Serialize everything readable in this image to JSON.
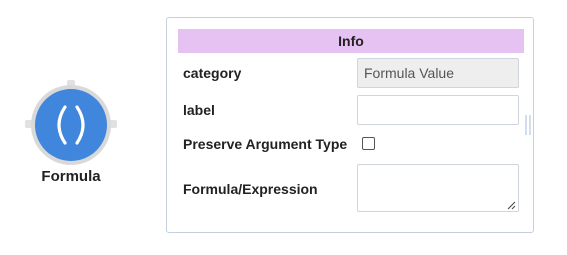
{
  "node": {
    "label": "Formula",
    "icon": "parentheses-icon",
    "color": "#3f86dc"
  },
  "info_panel": {
    "title": "Info",
    "header_color": "#e5c2f1",
    "fields": {
      "category": {
        "label": "category",
        "value": "Formula Value"
      },
      "label": {
        "label": "label",
        "value": ""
      },
      "preserve_argument_type": {
        "label": "Preserve Argument Type",
        "checked": false
      },
      "formula_expression": {
        "label": "Formula/Expression",
        "value": ""
      }
    }
  }
}
